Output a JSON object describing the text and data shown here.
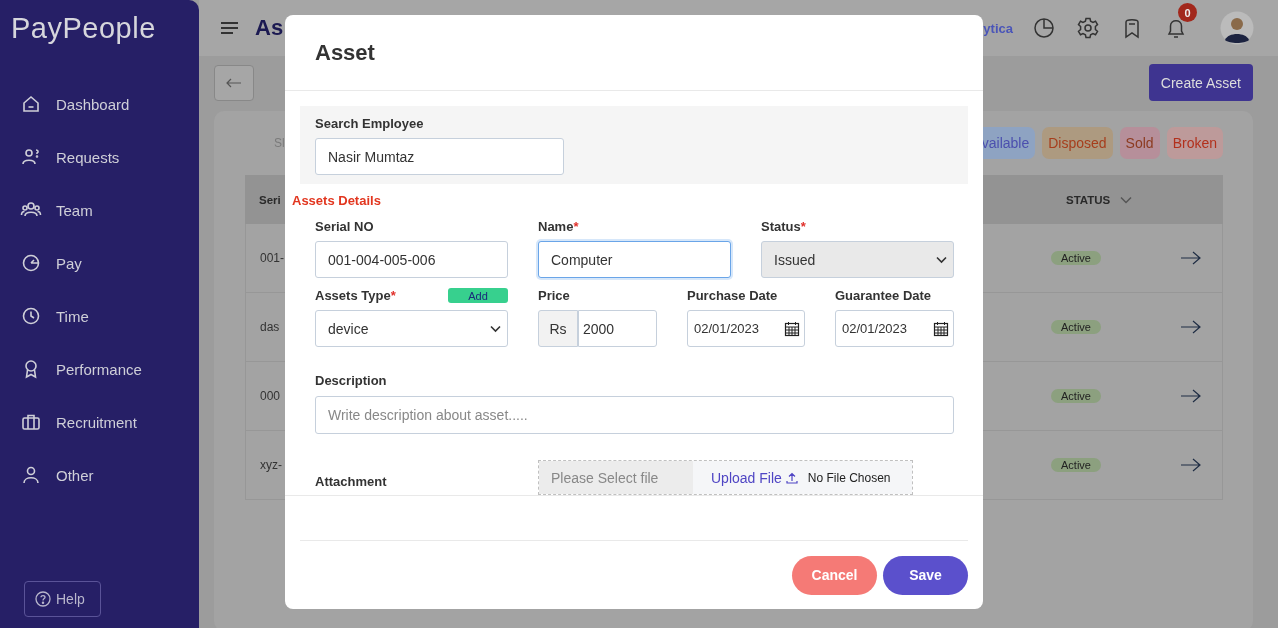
{
  "sidebar": {
    "logo": "PayPeople",
    "items": [
      {
        "label": "Dashboard",
        "selected": false
      },
      {
        "label": "Requests",
        "selected": false
      },
      {
        "label": "Team",
        "selected": false
      },
      {
        "label": "Pay",
        "selected": false
      },
      {
        "label": "Time",
        "selected": false
      },
      {
        "label": "Performance",
        "selected": false
      },
      {
        "label": "Recruitment",
        "selected": false
      },
      {
        "label": "Other",
        "selected": false
      }
    ],
    "help": "Help"
  },
  "topbar": {
    "title": "As",
    "link": "ytica",
    "notifications": "0"
  },
  "toolbar": {
    "create_button": "Create Asset"
  },
  "filters": {
    "label": "Sl",
    "tags": [
      {
        "label": "vailable",
        "color": "#8ea3c2"
      },
      {
        "label": "Disposed",
        "color": "#ad9a80"
      },
      {
        "label": "Sold",
        "color": "#b68f9a"
      },
      {
        "label": "Broken",
        "color": "#bd9a9a"
      }
    ]
  },
  "table": {
    "columns": [
      "Seri",
      "STATUS"
    ],
    "rows": [
      {
        "serial": "001-",
        "status": "Active"
      },
      {
        "serial": "das",
        "status": "Active"
      },
      {
        "serial": "000",
        "status": "Active"
      },
      {
        "serial": "xyz-",
        "status": "Active"
      }
    ]
  },
  "modal": {
    "title": "Asset",
    "search": {
      "label": "Search Employee",
      "value": "Nasir Mumtaz"
    },
    "section": "Assets Details",
    "rows": [
      [
        {
          "kind": "text",
          "label": "Serial NO",
          "value": "001-004-005-006",
          "focused": false
        },
        {
          "kind": "text",
          "label": "Name",
          "required_mark": "*",
          "value": "Computer",
          "focused": true
        },
        {
          "kind": "select",
          "label": "Status",
          "required_mark": "*",
          "value": "Issued",
          "disabled": true
        }
      ],
      [
        {
          "kind": "select",
          "label": "Assets Type",
          "required_mark": "*",
          "add_button": "Add",
          "value": "device",
          "disabled": false
        },
        {
          "kind": "price",
          "label": "Price",
          "prefix": "Rs",
          "value": "2000"
        },
        {
          "kind": "date",
          "label": "Purchase Date",
          "value": "02/01/2023"
        },
        {
          "kind": "date",
          "label": "Guarantee Date",
          "value": "02/01/2023"
        }
      ]
    ],
    "description": {
      "label": "Description",
      "placeholder": "Write description about asset....."
    },
    "attachment": {
      "label": "Attachment",
      "placeholder": "Please Select file",
      "upload": "Upload File",
      "status": "No File Chosen"
    },
    "buttons": {
      "cancel": "Cancel",
      "save": "Save"
    }
  }
}
